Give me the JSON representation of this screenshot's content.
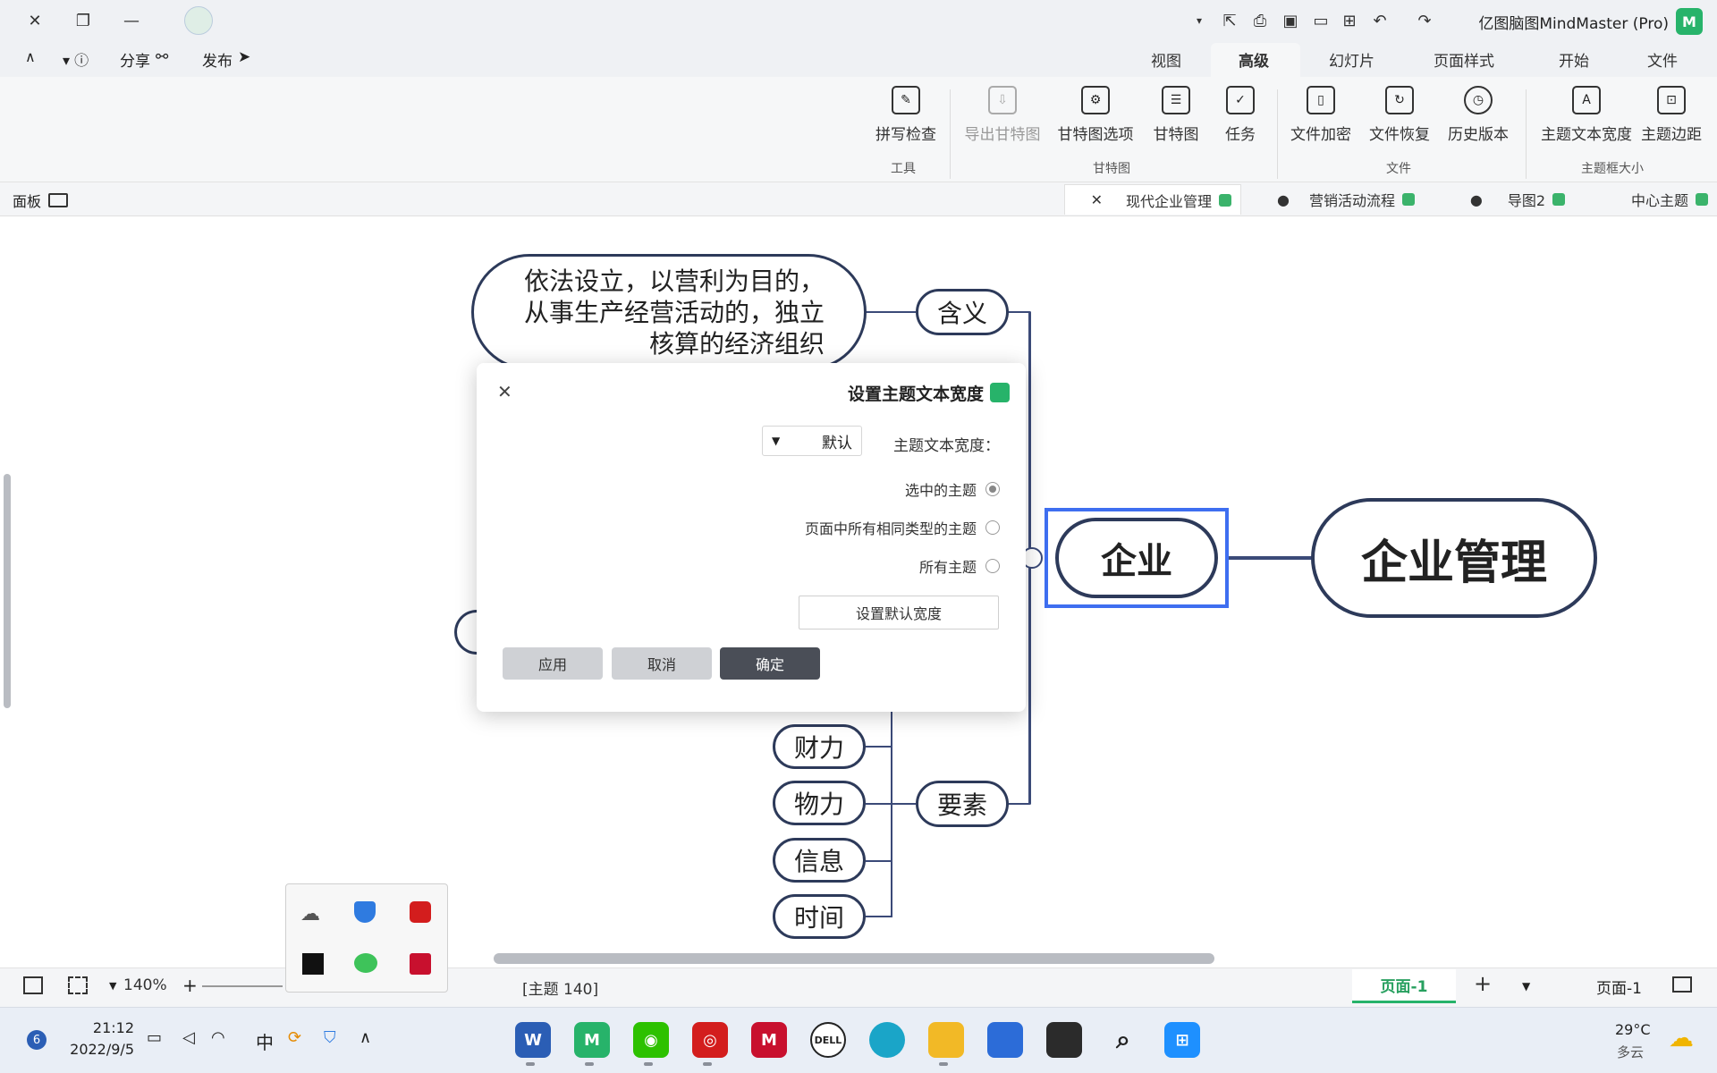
{
  "window": {
    "app_title": "亿图脑图MindMaster (Pro)",
    "controls": {
      "close": "✕",
      "restore": "❐",
      "minimize": "—"
    }
  },
  "menu": {
    "tabs": [
      "文件",
      "开始",
      "页面样式",
      "幻灯片",
      "高级",
      "视图"
    ],
    "active": "高级",
    "right_actions": {
      "publish": "发布",
      "share": "分享"
    }
  },
  "ribbon": {
    "groups": [
      {
        "label": "主题框大小",
        "buttons": [
          "主题边距",
          "主题文本宽度"
        ]
      },
      {
        "label": "文件",
        "buttons": [
          "历史版本",
          "文件恢复",
          "文件加密"
        ]
      },
      {
        "label": "甘特图",
        "buttons": [
          "任务",
          "甘特图",
          "甘特图选项",
          "导出甘特图"
        ]
      },
      {
        "label": "工具",
        "buttons": [
          "拼写检查"
        ]
      }
    ]
  },
  "doc_tabs": [
    "中心主题",
    "导图2",
    "营销活动流程",
    "现代企业管理"
  ],
  "active_doc_tab": "现代企业管理",
  "panel_toggle": "面板",
  "mindmap": {
    "root": "企业管理",
    "level1": "企业",
    "branch_meaning": "含义",
    "meaning_text": "依法设立，以营利为目的，从事生产经营活动的，独立核算的经济组织",
    "branch_elements": "要素",
    "elements": [
      "财力",
      "物力",
      "信息",
      "时间"
    ]
  },
  "dialog": {
    "title": "设置主题文本宽度",
    "width_label": "主题文本宽度：",
    "width_value": "默认",
    "options": [
      "选中的主题",
      "页面中所有相同类型的主题",
      "所有主题"
    ],
    "selected_option": "选中的主题",
    "set_default_button": "设置默认宽度",
    "ok": "确定",
    "cancel": "取消",
    "apply": "应用"
  },
  "statusbar": {
    "page_select": "页面-1",
    "page_tab": "页面-1",
    "topic_count": "[主题 140]",
    "zoom": "140%"
  },
  "taskbar": {
    "weather_temp": "29°C",
    "weather_desc": "多云",
    "time": "21:12",
    "date": "2022/9/5",
    "ime": "中",
    "notif_count": "6"
  }
}
